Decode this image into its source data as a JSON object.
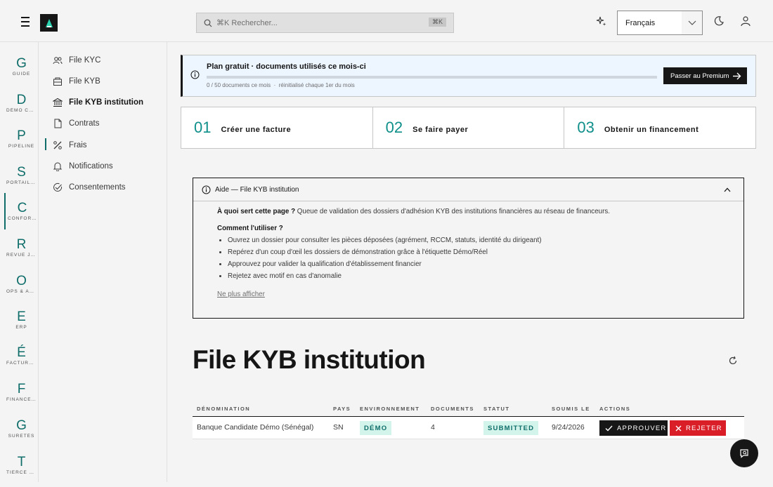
{
  "topbar": {
    "search_placeholder": "⌘K Rechercher...",
    "search_kbd": "⌘K",
    "language": "Français",
    "icons": [
      "menu-icon",
      "ai-sparkle-icon",
      "chevron-down-icon",
      "moon-icon",
      "user-icon"
    ]
  },
  "rail": [
    {
      "letter": "G",
      "label": "GUIDE"
    },
    {
      "letter": "D",
      "label": "DÉMO CRUD"
    },
    {
      "letter": "P",
      "label": "PIPELINE"
    },
    {
      "letter": "S",
      "label": "PORTAIL V..."
    },
    {
      "letter": "C",
      "label": "CONFORM..."
    },
    {
      "letter": "R",
      "label": "REVUE JU..."
    },
    {
      "letter": "O",
      "label": "OPS & AD..."
    },
    {
      "letter": "E",
      "label": "ERP"
    },
    {
      "letter": "É",
      "label": "FACTURAT..."
    },
    {
      "letter": "F",
      "label": "FINANCEM..."
    },
    {
      "letter": "G",
      "label": "SÛRETÉS"
    },
    {
      "letter": "T",
      "label": "TIERCE DE..."
    }
  ],
  "nav": [
    {
      "label": "File KYC",
      "icon": "users-icon"
    },
    {
      "label": "File KYB",
      "icon": "building-icon"
    },
    {
      "label": "File KYB institution",
      "icon": "bank-icon"
    },
    {
      "label": "Contrats",
      "icon": "document-icon"
    },
    {
      "label": "Frais",
      "icon": "percent-icon"
    },
    {
      "label": "Notifications",
      "icon": "bell-icon"
    },
    {
      "label": "Consentements",
      "icon": "check-circle-icon"
    }
  ],
  "plan": {
    "title": "Plan gratuit · documents utilisés ce mois-ci",
    "usage": "0 / 50 documents ce mois",
    "sep": "·",
    "reset": "réinitialisé chaque 1er du mois",
    "used_fraction": 0,
    "cta": "Passer au Premium"
  },
  "steps": [
    {
      "num": "01",
      "label": "Créer une facture"
    },
    {
      "num": "02",
      "label": "Se faire payer"
    },
    {
      "num": "03",
      "label": "Obtenir un financement"
    }
  ],
  "help": {
    "title": "Aide — File KYB institution",
    "q1": "À quoi sert cette page ?",
    "a1": " Queue de validation des dossiers d'adhésion KYB des institutions financières au réseau de financeurs.",
    "q2": "Comment l'utiliser ?",
    "items": [
      "Ouvrez un dossier pour consulter les pièces déposées (agrément, RCCM, statuts, identité du dirigeant)",
      "Repérez d'un coup d'œil les dossiers de démonstration grâce à l'étiquette Démo/Réel",
      "Approuvez pour valider la qualification d'établissement financier",
      "Rejetez avec motif en cas d'anomalie"
    ],
    "dismiss": "Ne plus afficher"
  },
  "page_title": "File KYB institution",
  "table": {
    "headers": [
      "DÉNOMINATION",
      "PAYS",
      "ENVIRONNEMENT",
      "DOCUMENTS",
      "STATUT",
      "SOUMIS LE",
      "ACTIONS"
    ],
    "rows": [
      {
        "name": "Banque Candidate Démo (Sénégal)",
        "country": "SN",
        "env": "DÉMO",
        "docs": "4",
        "status": "SUBMITTED",
        "date": "9/24/2026"
      }
    ],
    "approve": "APPROUVER",
    "reject": "REJETER"
  }
}
